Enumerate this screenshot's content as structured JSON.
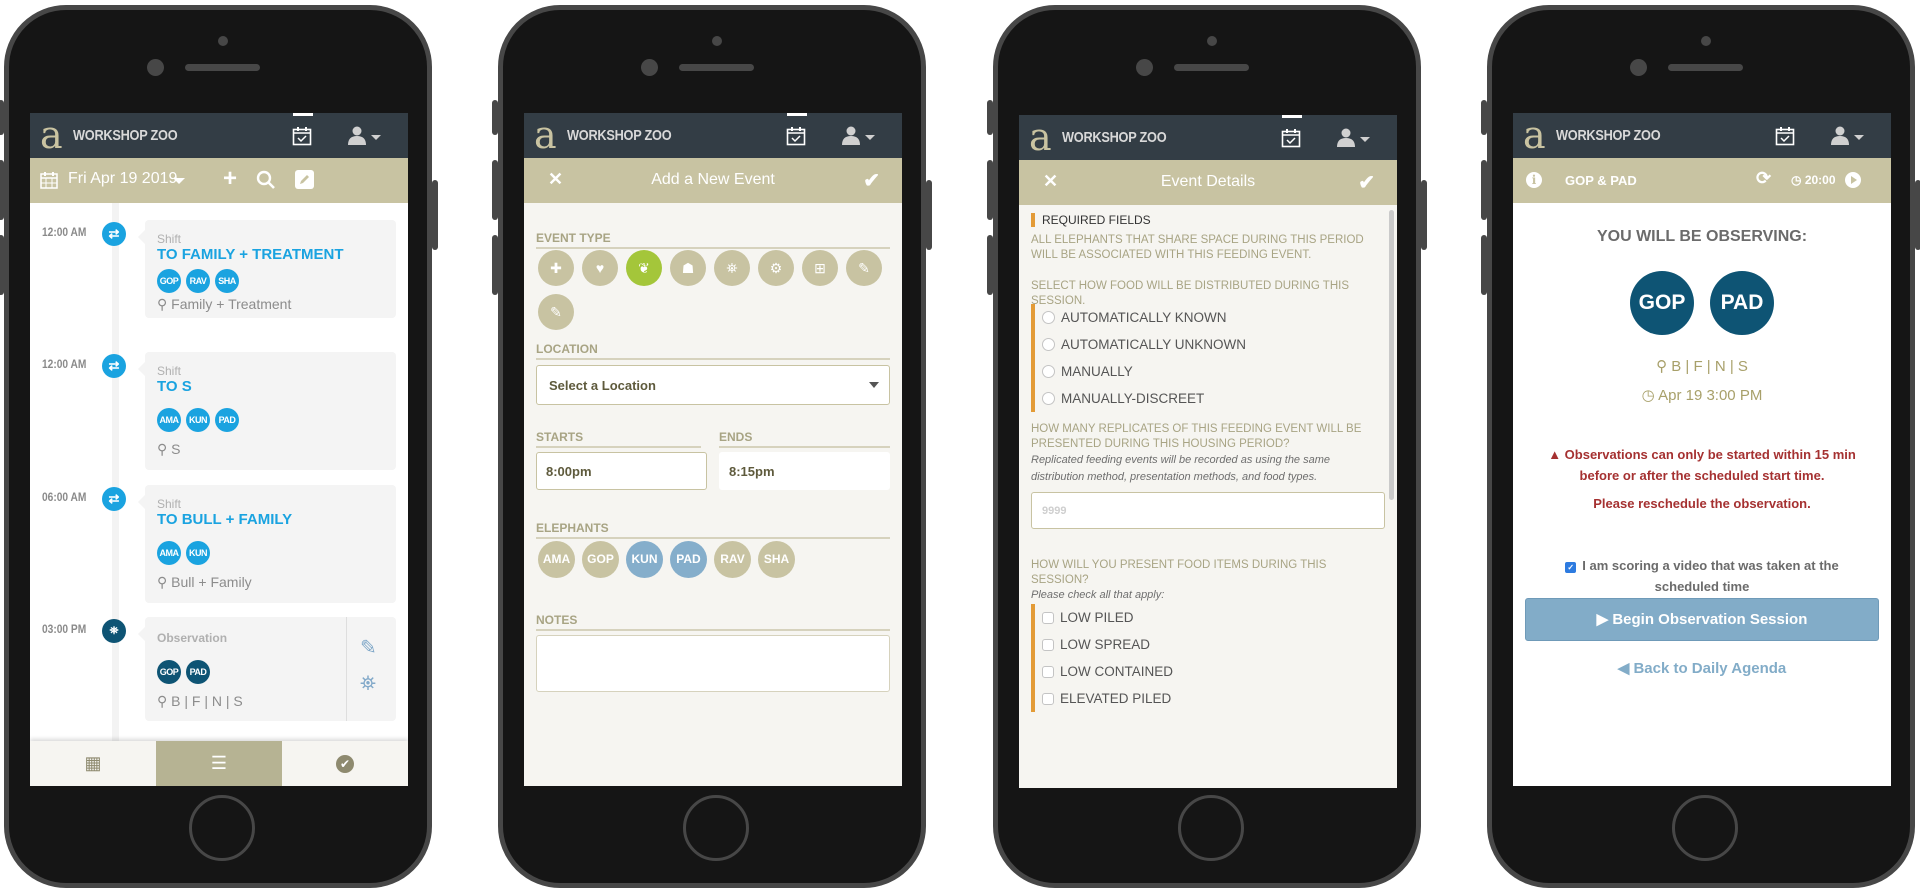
{
  "app": {
    "brand": "WORKSHOP ZOO",
    "logo_glyph": "a",
    "icons": {
      "calendar_check": "calendar-check-icon",
      "user_menu": "user-dropdown-icon"
    }
  },
  "colors": {
    "header_dark": "#333d45",
    "subheader_olive": "#c8c3a2",
    "shift_blue": "#1aa3e0",
    "observation_navy": "#0e5474",
    "selected_blue": "#85aecb",
    "event_type_active": "#a4c63a",
    "required_orange": "#e39b37",
    "warning_red": "#a53131"
  },
  "agenda": {
    "date": "Fri Apr 19 2019",
    "events": [
      {
        "time": "12:00 AM",
        "kind": "Shift",
        "name": "TO FAMILY + TREATMENT",
        "elephants": [
          "GOP",
          "RAV",
          "SHA"
        ],
        "location": "Family + Treatment",
        "icon": "shift-arrows-icon"
      },
      {
        "time": "12:00 AM",
        "kind": "Shift",
        "name": "TO S",
        "elephants": [
          "AMA",
          "KUN",
          "PAD"
        ],
        "location": "S",
        "icon": "shift-arrows-icon"
      },
      {
        "time": "06:00 AM",
        "kind": "Shift",
        "name": "TO BULL + FAMILY",
        "elephants": [
          "AMA",
          "KUN"
        ],
        "location": "Bull + Family",
        "icon": "shift-arrows-icon"
      },
      {
        "time": "03:00 PM",
        "kind": "Observation",
        "name": "",
        "elephants": [
          "GOP",
          "PAD"
        ],
        "location": "B | F | N | S",
        "icon": "binoculars-icon"
      }
    ],
    "tabs": [
      {
        "name": "calendar",
        "active": false
      },
      {
        "name": "list",
        "active": true
      },
      {
        "name": "completed",
        "active": false
      }
    ]
  },
  "new_event": {
    "title": "Add a New Event",
    "event_type_label": "EVENT TYPE",
    "event_types": [
      {
        "icon": "puzzle-icon",
        "active": false
      },
      {
        "icon": "heartbeat-icon",
        "active": false
      },
      {
        "icon": "leaf-feeding-icon",
        "active": true
      },
      {
        "icon": "person-icon",
        "active": false
      },
      {
        "icon": "binoculars-icon",
        "active": false
      },
      {
        "icon": "gear-icon",
        "active": false
      },
      {
        "icon": "medkit-icon",
        "active": false
      },
      {
        "icon": "pencil-icon",
        "active": false
      },
      {
        "icon": "pencil-icon",
        "active": false
      }
    ],
    "location_label": "LOCATION",
    "location_value": "Select a Location",
    "starts_label": "STARTS",
    "starts_value": "8:00pm",
    "ends_label": "ENDS",
    "ends_value": "8:15pm",
    "elephants_label": "ELEPHANTS",
    "elephants": [
      {
        "code": "AMA",
        "selected": false
      },
      {
        "code": "GOP",
        "selected": false
      },
      {
        "code": "KUN",
        "selected": true
      },
      {
        "code": "PAD",
        "selected": true
      },
      {
        "code": "RAV",
        "selected": false
      },
      {
        "code": "SHA",
        "selected": false
      }
    ],
    "notes_label": "NOTES",
    "notes_value": ""
  },
  "event_details": {
    "title": "Event Details",
    "required_label": "REQUIRED FIELDS",
    "share_note": "ALL ELEPHANTS THAT SHARE SPACE DURING THIS PERIOD WILL BE ASSOCIATED WITH THIS FEEDING EVENT.",
    "distribution_question": "SELECT HOW FOOD WILL BE DISTRIBUTED DURING THIS SESSION.",
    "distribution_options": [
      "AUTOMATICALLY KNOWN",
      "AUTOMATICALLY UNKNOWN",
      "MANUALLY",
      "MANUALLY-DISCREET"
    ],
    "replicates_question": "HOW MANY REPLICATES OF THIS FEEDING EVENT WILL BE PRESENTED DURING THIS HOUSING PERIOD?",
    "replicates_hint": "Replicated feeding events will be recorded as using the same distribution method, presentation methods, and food types.",
    "replicates_placeholder": "9999",
    "presentation_question": "HOW WILL YOU PRESENT FOOD ITEMS DURING THIS SESSION?",
    "presentation_hint": "Please check all that apply:",
    "presentation_options": [
      "LOW PILED",
      "LOW SPREAD",
      "LOW CONTAINED",
      "ELEVATED PILED"
    ]
  },
  "observation": {
    "title": "GOP & PAD",
    "timer": "20:00",
    "heading": "YOU WILL BE OBSERVING:",
    "elephants": [
      "GOP",
      "PAD"
    ],
    "location": "B | F | N | S",
    "datetime": "Apr 19 3:00 PM",
    "warning": "Observations can only be started within 15 min before or after the scheduled start time.",
    "reschedule": "Please reschedule the observation.",
    "video_checkbox_label": "I am scoring a video that was taken at the scheduled time",
    "video_checkbox_checked": true,
    "begin_button": "Begin Observation Session",
    "back_link": "Back to Daily Agenda"
  }
}
